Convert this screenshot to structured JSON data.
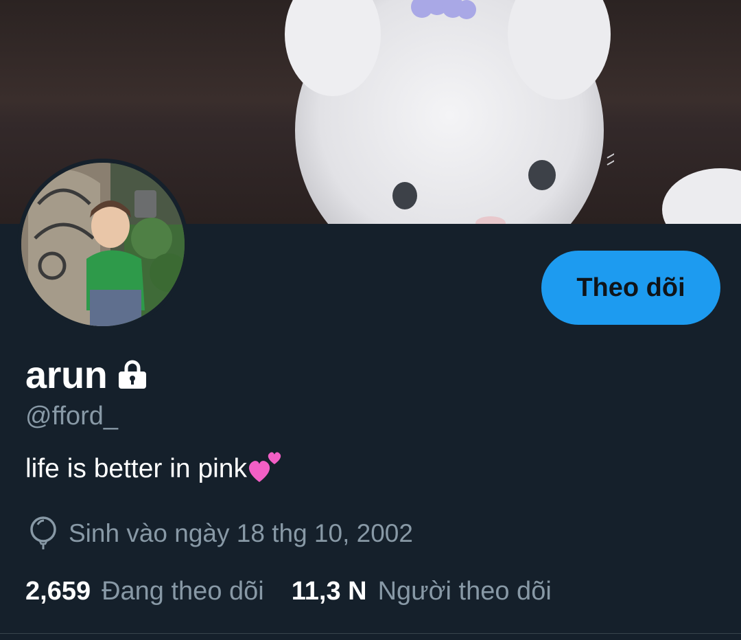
{
  "profile": {
    "display_name": "arun",
    "handle": "@fford_",
    "bio": "life is better in pink",
    "bio_emoji": "two-hearts-icon",
    "birthday": "Sinh vào ngày 18 thg 10, 2002",
    "following_count": "2,659",
    "following_label": "Đang theo dõi",
    "followers_count": "11,3 N",
    "followers_label": "Người theo dõi",
    "protected_icon": "lock-icon"
  },
  "actions": {
    "follow_label": "Theo dõi"
  },
  "colors": {
    "background": "#15202b",
    "accent": "#1d9bf0",
    "secondary_text": "#8899a6",
    "primary_text": "#ffffff"
  }
}
